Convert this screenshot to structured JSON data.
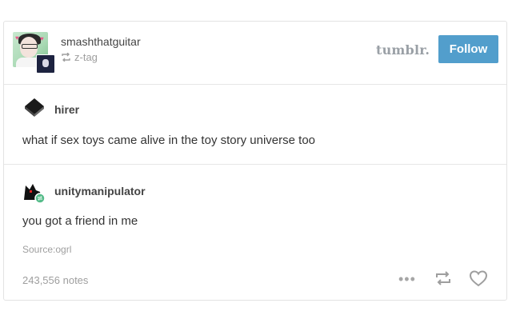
{
  "header": {
    "username": "smashthatguitar",
    "reblogged_from": "z-tag",
    "logo_text": "tumblr.",
    "follow_label": "Follow"
  },
  "posts": [
    {
      "author": "hirer",
      "text": "what if sex toys came alive in the toy story universe too"
    },
    {
      "author": "unitymanipulator",
      "text": "you got a friend in me"
    }
  ],
  "footer": {
    "source_label": "Source:",
    "source_value": "ogrl",
    "notes": "243,556 notes"
  },
  "colors": {
    "accent": "#529ecc",
    "muted": "#9e9e9e",
    "reblog_badge": "#56bc8a"
  },
  "icons": [
    "reblog-icon",
    "more-icon",
    "heart-icon"
  ]
}
